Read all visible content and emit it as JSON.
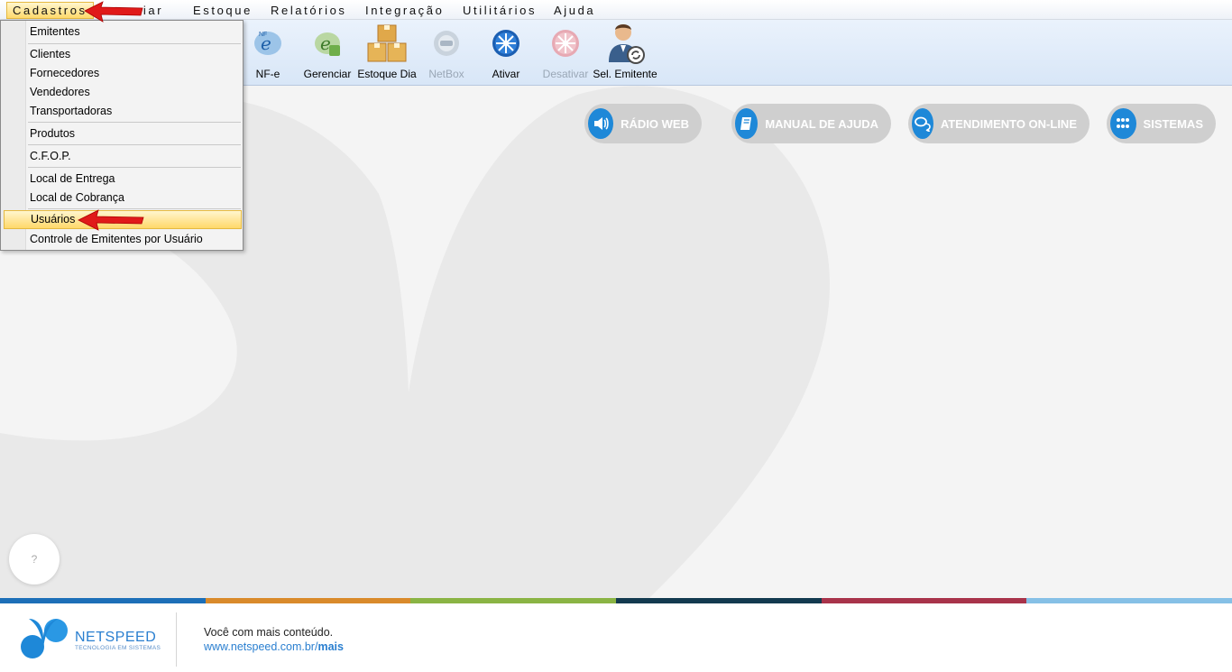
{
  "menubar": {
    "items": [
      "Cadastros",
      "Gerenciar",
      "Estoque",
      "Relatórios",
      "Integração",
      "Utilitários",
      "Ajuda"
    ],
    "visible_partial_second": "nciar"
  },
  "toolbar": {
    "buttons": [
      {
        "label": "NF-e",
        "icon": "nfe-icon",
        "enabled": true
      },
      {
        "label": "Gerenciar",
        "icon": "manage-nfe-icon",
        "enabled": true
      },
      {
        "label": "Estoque Dia",
        "icon": "boxes-icon",
        "enabled": true
      },
      {
        "label": "NetBox",
        "icon": "netbox-icon",
        "enabled": false
      },
      {
        "label": "Ativar",
        "icon": "activate-icon",
        "enabled": true
      },
      {
        "label": "Desativar",
        "icon": "deactivate-icon",
        "enabled": false
      },
      {
        "label": "Sel. Emitente",
        "icon": "select-issuer-icon",
        "enabled": true
      }
    ]
  },
  "dropdown": {
    "items": [
      "Emitentes",
      "Clientes",
      "Fornecedores",
      "Vendedores",
      "Transportadoras",
      "Produtos",
      "C.F.O.P.",
      "Local de Entrega",
      "Local de Cobrança",
      "Usuários",
      "Controle de Emitentes por Usuário"
    ],
    "highlighted": "Usuários"
  },
  "quick_links": {
    "radio": "RÁDIO WEB",
    "manual": "MANUAL DE AJUDA",
    "support": "ATENDIMENTO ON-LINE",
    "systems": "SISTEMAS"
  },
  "help_button": "?",
  "footer": {
    "brand": "NETSPEED",
    "tagline": "TECNOLOGIA EM SISTEMAS",
    "line1": "Você com mais conteúdo.",
    "line2_prefix": "www.netspeed.com.br/",
    "line2_bold": "mais"
  },
  "colors": {
    "accent": "#1e88d8",
    "stripes": [
      "#1d6fb8",
      "#d98a2b",
      "#8ab444",
      "#133a4f",
      "#a8334a",
      "#86c0e6"
    ]
  }
}
